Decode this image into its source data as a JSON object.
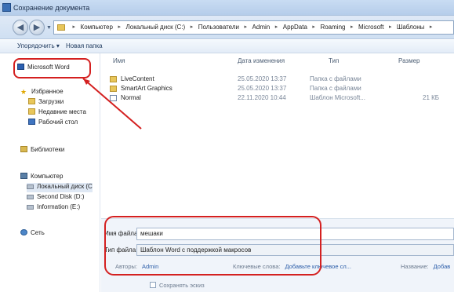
{
  "window": {
    "title": "Сохранение документа"
  },
  "address": {
    "crumbs": [
      "Компьютер",
      "Локальный диск (C:)",
      "Пользователи",
      "Admin",
      "AppData",
      "Roaming",
      "Microsoft",
      "Шаблоны"
    ]
  },
  "toolbar": {
    "organize": "Упорядочить ▾",
    "new_folder": "Новая папка"
  },
  "sidebar": {
    "items": [
      {
        "label": "Microsoft Word",
        "icon": "word-icon"
      },
      {
        "label": "Избранное",
        "icon": "star-icon"
      },
      {
        "label": "Загрузки",
        "icon": "folder-icon"
      },
      {
        "label": "Недавние места",
        "icon": "folder-icon"
      },
      {
        "label": "Рабочий стол",
        "icon": "desktop-icon"
      },
      {
        "label": "Библиотеки",
        "icon": "library-icon"
      },
      {
        "label": "Компьютер",
        "icon": "computer-icon"
      },
      {
        "label": "Локальный диск (C",
        "icon": "drive-icon"
      },
      {
        "label": "Second Disk (D:)",
        "icon": "drive-icon"
      },
      {
        "label": "Information (E:)",
        "icon": "drive-icon"
      },
      {
        "label": "Сеть",
        "icon": "network-icon"
      }
    ]
  },
  "filelist": {
    "columns": {
      "name": "Имя",
      "date": "Дата изменения",
      "type": "Тип",
      "size": "Размер"
    },
    "rows": [
      {
        "name": "LiveContent",
        "date": "25.05.2020 13:37",
        "type": "Папка с файлами",
        "size": "",
        "icon": "folder-icon"
      },
      {
        "name": "SmartArt Graphics",
        "date": "25.05.2020 13:37",
        "type": "Папка с файлами",
        "size": "",
        "icon": "folder-icon"
      },
      {
        "name": "Normal",
        "date": "22.11.2020 10:44",
        "type": "Шаблон Microsoft...",
        "size": "21 КБ",
        "icon": "word-template-icon"
      }
    ]
  },
  "save": {
    "filename_label": "Имя файла:",
    "filename_value": "мешаки",
    "filetype_label": "Тип файла:",
    "filetype_value": "Шаблон Word с поддержкой макросов",
    "authors_label": "Авторы:",
    "authors_value": "Admin",
    "tags_label": "Ключевые слова:",
    "tags_value": "Добавьте ключевое сл...",
    "title_label": "Название:",
    "title_value": "Добав",
    "thumbnail_label": "Сохранять эскиз"
  },
  "colors": {
    "highlight": "#d42020",
    "link": "#2a5ca8"
  }
}
